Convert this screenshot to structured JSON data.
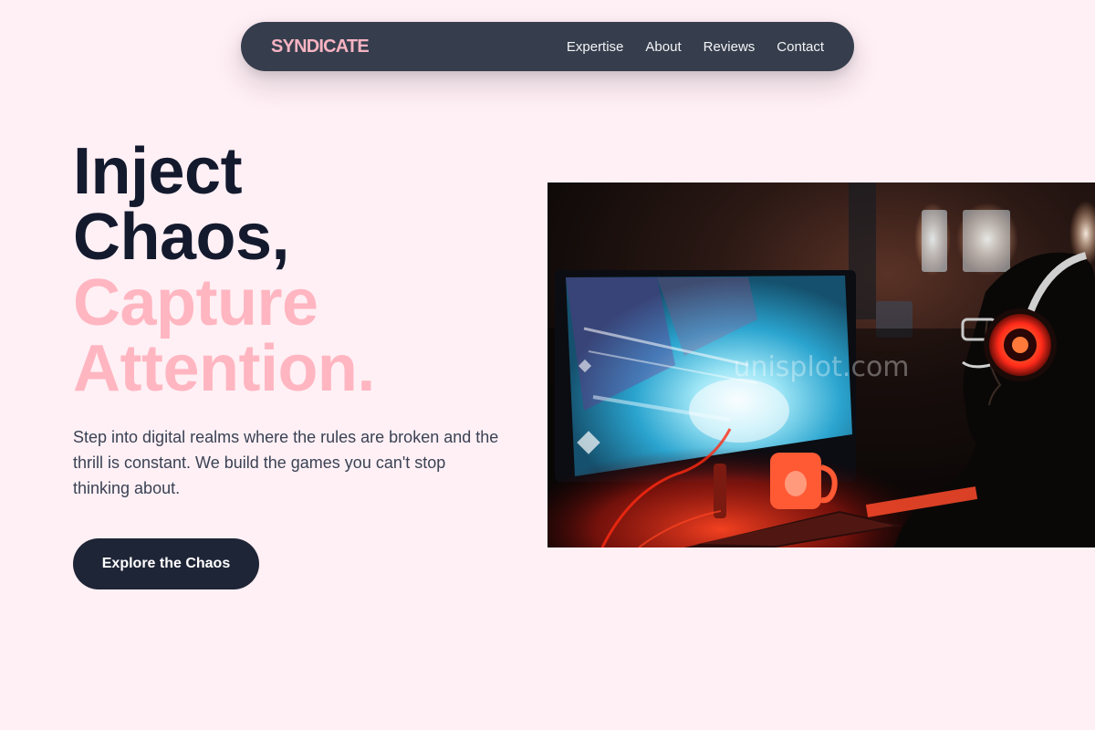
{
  "nav": {
    "brand": "SYNDICATE",
    "links": [
      "Expertise",
      "About",
      "Reviews",
      "Contact"
    ]
  },
  "hero": {
    "title_lines_dark": [
      "Inject",
      "Chaos,"
    ],
    "title_lines_accent": [
      "Capture",
      "Attention."
    ],
    "description": "Step into digital realms where the rules are broken and the thrill is constant. We build the games you can't stop thinking about.",
    "cta_label": "Explore the Chaos",
    "image_watermark": "unisplot.com"
  },
  "colors": {
    "page_background": "#fff0f5",
    "nav_background": "#363e4d",
    "brand": "#f7b3c2",
    "title_dark": "#141a2e",
    "title_accent": "#ffb6c1",
    "body_text": "#3a4254",
    "button_background": "#1e2536",
    "button_text": "#ffffff"
  }
}
